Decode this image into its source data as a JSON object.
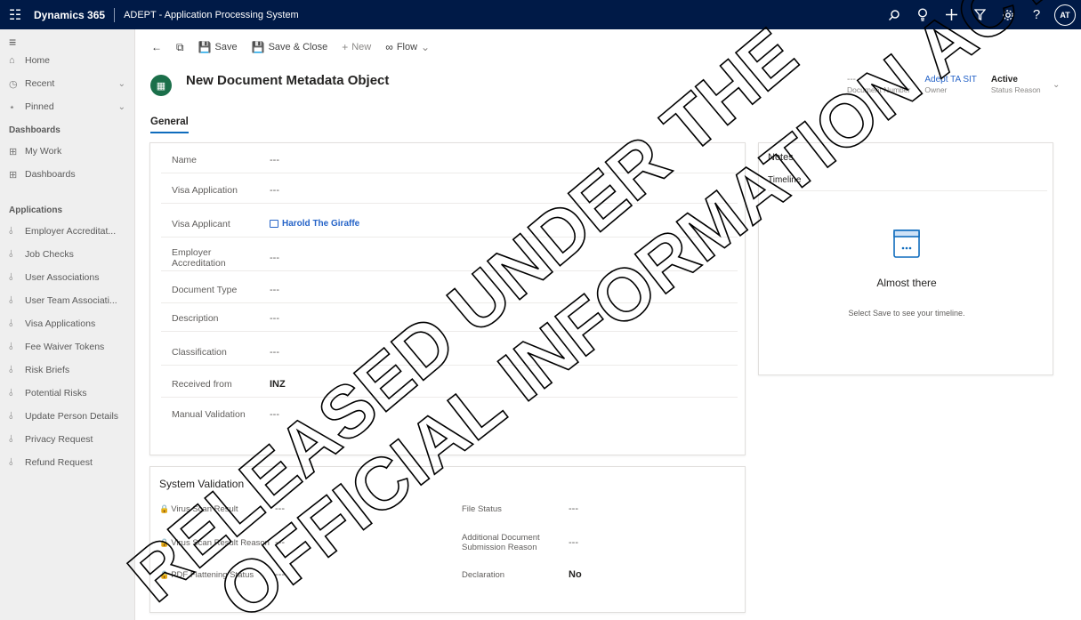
{
  "topbar": {
    "product": "Dynamics 365",
    "app_name": "ADEPT - Application Processing System",
    "avatar_initials": "AT",
    "icons": [
      "search-icon",
      "lightbulb-icon",
      "plus-icon",
      "filter-icon",
      "settings-icon",
      "help-icon"
    ]
  },
  "sidebar": {
    "home": "Home",
    "recent": "Recent",
    "pinned": "Pinned",
    "dashboards_section": "Dashboards",
    "my_work": "My Work",
    "dashboards": "Dashboards",
    "applications_section": "Applications",
    "apps": [
      "Employer Accreditat...",
      "Job Checks",
      "User Associations",
      "User Team Associati...",
      "Visa Applications",
      "Fee Waiver Tokens",
      "Risk Briefs",
      "Potential Risks",
      "Update Person Details",
      "Privacy Request",
      "Refund Request"
    ]
  },
  "commandbar": {
    "save": "Save",
    "save_close": "Save & Close",
    "new": "New",
    "flow": "Flow"
  },
  "header": {
    "title": "New Document Metadata Object",
    "fields": [
      {
        "value": "---",
        "label": "Document Number"
      },
      {
        "value": "Adept TA SIT",
        "label": "Owner"
      },
      {
        "value": "Active",
        "label": "Status Reason"
      }
    ]
  },
  "tabs": [
    "General"
  ],
  "general": {
    "fields": [
      {
        "label": "Name",
        "value": "---"
      },
      {
        "label": "Visa Application",
        "value": "---"
      },
      {
        "label": "Visa Applicant",
        "value": "Harold The Giraffe"
      },
      {
        "label": "Employer Accreditation",
        "value": "---"
      },
      {
        "label": "Document Type",
        "value": "---"
      },
      {
        "label": "Description",
        "value": "---"
      },
      {
        "label": "Classification",
        "value": "---"
      },
      {
        "label": "Received from",
        "value": "INZ"
      },
      {
        "label": "Manual Validation",
        "value": "---"
      }
    ]
  },
  "system_validation": {
    "title": "System Validation",
    "left": [
      {
        "label": "Virus Scan Result",
        "value": "---"
      },
      {
        "label": "Virus Scan Result Reason",
        "value": "---"
      },
      {
        "label": "PDF Flattening Status",
        "value": "---"
      }
    ],
    "right": [
      {
        "label": "File Status",
        "value": "---"
      },
      {
        "label": "Additional Document Submission Reason",
        "value": "---"
      },
      {
        "label": "Declaration",
        "value": "No"
      }
    ]
  },
  "notes": {
    "title": "Notes",
    "timeline": "Timeline",
    "empty_heading": "Almost there",
    "empty_text": "Select Save to see your timeline."
  },
  "watermark": {
    "line1": "RELEASED UNDER THE",
    "line2": "OFFICIAL INFORMATION ACT"
  }
}
